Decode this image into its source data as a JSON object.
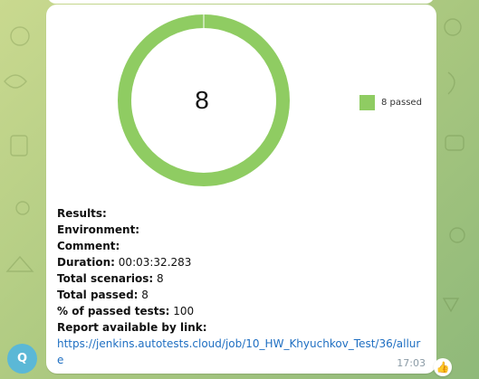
{
  "message": {
    "time": "17:03",
    "avatar_letter": "Q",
    "reaction": "👍"
  },
  "chart_data": {
    "type": "pie",
    "donut": true,
    "center_label": "8",
    "series": [
      {
        "name": "8 passed",
        "value": 8,
        "color": "#8fcc62"
      }
    ],
    "legend_position": "right"
  },
  "report": {
    "results_label": "Results:",
    "environment_label": "Environment:",
    "comment_label": "Comment:",
    "duration_label": "Duration:",
    "duration_value": "00:03:32.283",
    "total_scenarios_label": "Total scenarios:",
    "total_scenarios_value": "8",
    "total_passed_label": "Total passed:",
    "total_passed_value": "8",
    "percent_passed_label": "% of passed tests:",
    "percent_passed_value": "100",
    "report_link_label": "Report available by link:",
    "report_url": "https://jenkins.autotests.cloud/job/10_HW_Khyuchkov_Test/36/allure"
  }
}
